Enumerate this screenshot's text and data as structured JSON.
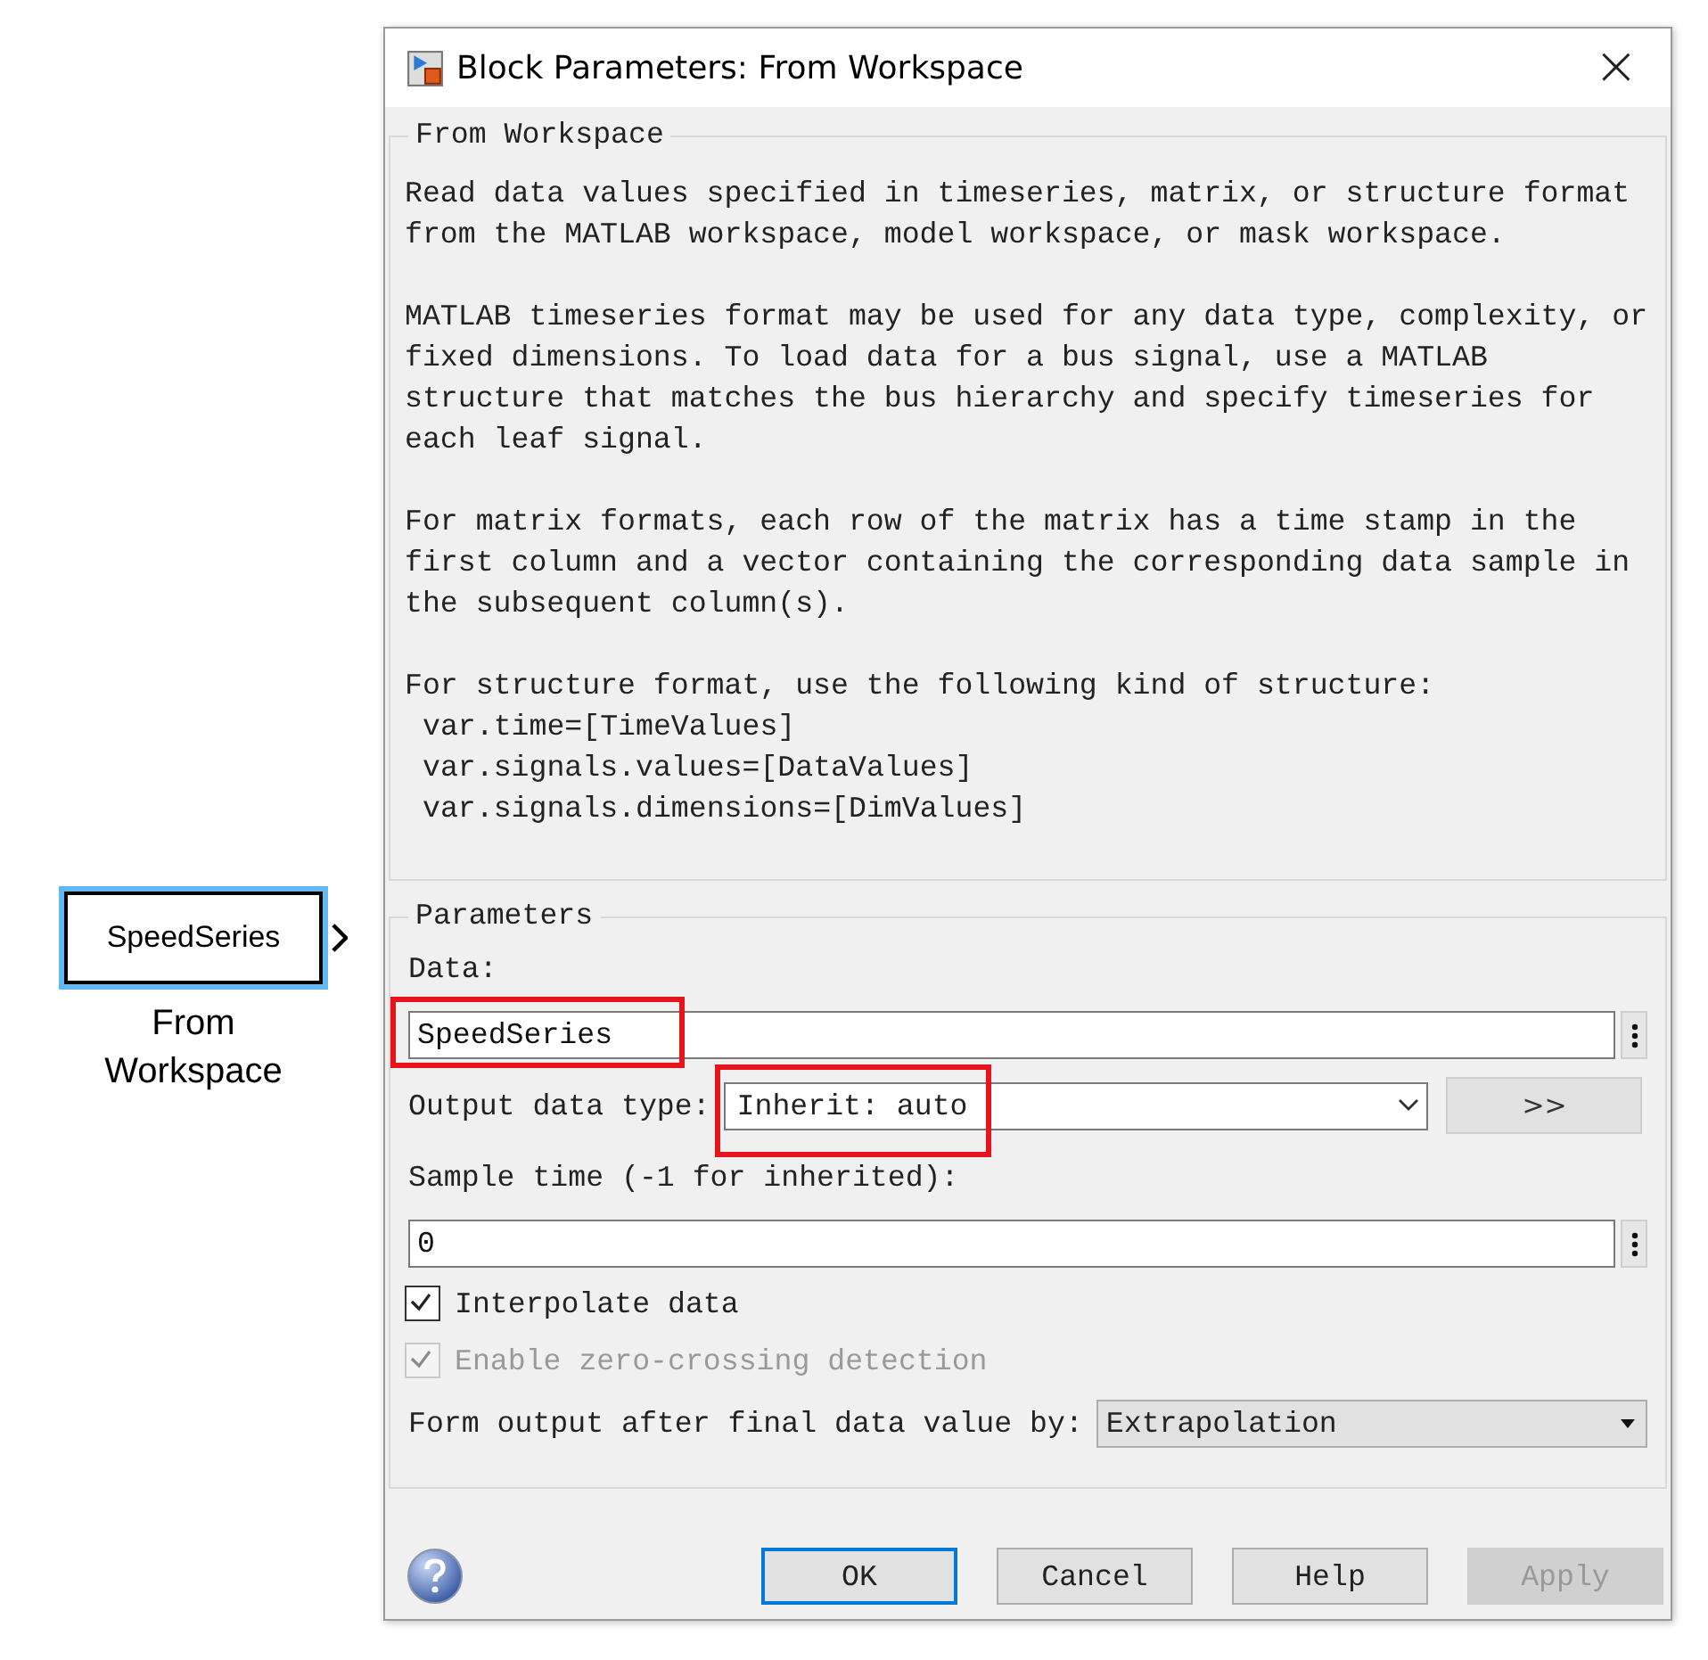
{
  "canvas_block": {
    "label": "SpeedSeries",
    "caption": "From Workspace",
    "selected": true
  },
  "window": {
    "title": "Block Parameters: From Workspace",
    "close": "×"
  },
  "description": {
    "title": "From Workspace",
    "paragraphs": [
      "Read data values specified in timeseries, matrix, or structure format from the MATLAB workspace, model workspace, or mask workspace.",
      "MATLAB timeseries format may be used for any data type, complexity, or fixed dimensions. To load data for a bus signal, use a MATLAB structure that matches the bus hierarchy and specify timeseries for each leaf signal.",
      "For matrix formats, each row of the matrix has a time stamp in the first column and a vector containing the corresponding data sample in the subsequent column(s).",
      "For structure format, use the following kind of structure:"
    ],
    "code_lines": [
      "var.time=[TimeValues]",
      "var.signals.values=[DataValues]",
      "var.signals.dimensions=[DimValues]"
    ]
  },
  "parameters": {
    "title": "Parameters",
    "data": {
      "label": "Data:",
      "value": "SpeedSeries",
      "highlighted": true
    },
    "output_type": {
      "label": "Output data type:",
      "value": "Inherit: auto",
      "highlighted": true,
      "button": ">>"
    },
    "sample_time": {
      "label": "Sample time (-1 for inherited):",
      "value": "0"
    },
    "checkboxes": [
      {
        "label": "Interpolate data",
        "checked": true,
        "disabled": false
      },
      {
        "label": "Enable zero-crossing detection",
        "checked": true,
        "disabled": true
      }
    ],
    "final_value": {
      "label": "Form output after final data value by:",
      "value": "Extrapolation"
    }
  },
  "buttons": [
    {
      "label": "OK",
      "selected": true,
      "disabled": false
    },
    {
      "label": "Cancel",
      "selected": false,
      "disabled": false
    },
    {
      "label": "Help",
      "selected": false,
      "disabled": false
    },
    {
      "label": "Apply",
      "selected": false,
      "disabled": true
    }
  ]
}
